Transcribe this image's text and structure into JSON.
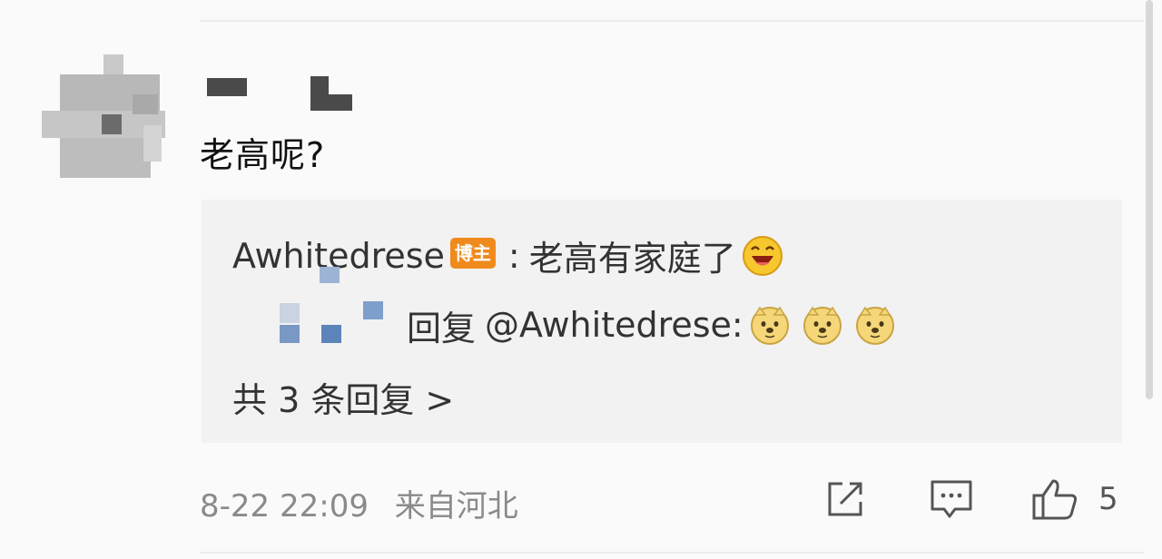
{
  "comment": {
    "text": "老高呢?"
  },
  "replies": {
    "reply1": {
      "author": "Awhitedrese",
      "badge": "博主",
      "separator": ":",
      "text": "老高有家庭了",
      "emoji": "laughing-face-icon"
    },
    "reply2": {
      "prefix": "回复",
      "mention": "@Awhitedrese:",
      "emoji": "doge-face-icon",
      "emoji_count": 3
    },
    "more": "共 3 条回复 >"
  },
  "footer": {
    "timestamp": "8-22 22:09",
    "source": "来自河北",
    "like_count": "5"
  },
  "colors": {
    "background": "#fafafa",
    "reply_background": "#f2f2f2",
    "badge": "#f08a1c",
    "meta_text": "#8a8a8a"
  }
}
